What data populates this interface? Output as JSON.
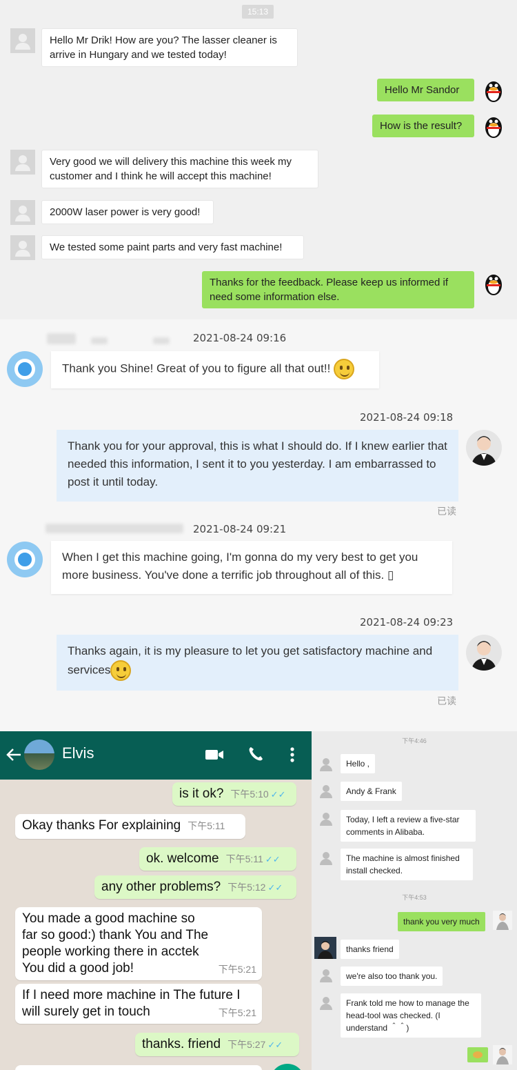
{
  "qq_chat": {
    "time": "15:13",
    "messages": [
      {
        "text": "Hello Mr Drik! How are you? The lasser cleaner is arrive in Hungary and we tested today!"
      },
      {
        "text": "Hello Mr Sandor"
      },
      {
        "text": "How is the result?"
      },
      {
        "text": "Very good we will delivery this machine this week my customer and I think he will accept this machine!"
      },
      {
        "text": "2000W laser power is very good!"
      },
      {
        "text": "We tested some paint parts and very fast machine!"
      },
      {
        "text": "Thanks for the feedback. Please keep us informed if need some information else."
      }
    ]
  },
  "web_chat": {
    "messages": [
      {
        "time": "2021-08-24 09:16",
        "text": "Thank you Shine! Great of you to figure all that out!!"
      },
      {
        "time": "2021-08-24 09:18",
        "text": "Thank you for your approval, this is what I should do. If I knew earlier that needed this information, I sent it to you yesterday. I am embarrassed to post it until today.",
        "status": "已读"
      },
      {
        "time": "2021-08-24 09:21",
        "text": "When I get this machine going, I'm gonna do my very best to get you more business. You've done a terrific job throughout all of this. ▯"
      },
      {
        "time": "2021-08-24 09:23",
        "text": "Thanks again, it is my pleasure to let you get satisfactory machine and services",
        "status": "已读"
      }
    ]
  },
  "whatsapp": {
    "contact_name": "Elvis",
    "messages": [
      {
        "text": "is it ok?",
        "time": "下午5:10",
        "read": "✓✓"
      },
      {
        "text": "Okay thanks For explaining",
        "time": "下午5:11"
      },
      {
        "text": "ok.  welcome",
        "time": "下午5:11",
        "read": "✓✓"
      },
      {
        "text": "any other problems?",
        "time": "下午5:12",
        "read": "✓✓"
      },
      {
        "text": "You made a good machine so far so good:) thank You and The people working there in acctek You did a good job!",
        "time": "下午5:21"
      },
      {
        "text": "If I need more machine in The future I will surely get in touch",
        "time": "下午5:21"
      },
      {
        "text": "thanks. friend",
        "time": "下午5:27",
        "read": "✓✓"
      }
    ]
  },
  "qq_chat2": {
    "time1": "下午4:46",
    "time2": "下午4:53",
    "messages": [
      {
        "text": "Hello ,"
      },
      {
        "text": "Andy  & Frank"
      },
      {
        "text": "Today, I left a  review a five-star comments in Alibaba."
      },
      {
        "text": "The machine is almost finished install checked."
      },
      {
        "text": "thank you very much"
      },
      {
        "text": "thanks friend"
      },
      {
        "text": "we're also too thank you."
      },
      {
        "text": "Frank told me how to manage the head-tool was checked. (I understand  ＾＾)"
      }
    ]
  },
  "colors": {
    "qq_green": "#9ae05f",
    "wa_header": "#075e54",
    "wa_outgoing": "#dcf8c6",
    "read_tick": "#4fb6ec"
  },
  "icons": [
    "person-avatar-icon",
    "qq-penguin-icon",
    "video-call-icon",
    "phone-icon",
    "more-vert-icon",
    "back-arrow-icon",
    "emoji-smile-icon"
  ]
}
